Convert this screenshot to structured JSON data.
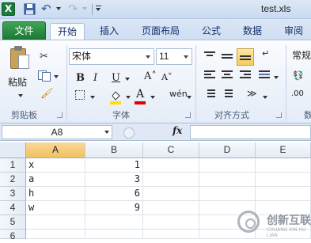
{
  "window": {
    "title": "test.xls"
  },
  "tabs": [
    "文件",
    "开始",
    "插入",
    "页面布局",
    "公式",
    "数据",
    "审阅"
  ],
  "ribbon": {
    "clipboard": {
      "paste_label": "粘贴",
      "group_label": "剪贴板"
    },
    "font": {
      "font_name": "宋体",
      "font_size": "11",
      "bold": "B",
      "italic": "I",
      "underline": "U",
      "grow": "A˄",
      "shrink": "A˅",
      "font_color": "A",
      "phonetic": "wén",
      "group_label": "字体"
    },
    "alignment": {
      "group_label": "对齐方式"
    },
    "number": {
      "format_label": "常规",
      "group_label_partial": "数"
    }
  },
  "formula_bar": {
    "name_box": "A8",
    "fx": "fx",
    "formula": ""
  },
  "grid": {
    "columns": [
      "A",
      "B",
      "C",
      "D",
      "E"
    ],
    "rows": [
      {
        "n": "1",
        "a": "x",
        "b": "1"
      },
      {
        "n": "2",
        "a": "a",
        "b": "3"
      },
      {
        "n": "3",
        "a": "h",
        "b": "6"
      },
      {
        "n": "4",
        "a": "w",
        "b": "9"
      },
      {
        "n": "5",
        "a": "",
        "b": ""
      },
      {
        "n": "6",
        "a": "",
        "b": ""
      }
    ]
  },
  "watermark": {
    "text": "创新互联",
    "sub": "CHUANG XIN HU LIAN"
  }
}
